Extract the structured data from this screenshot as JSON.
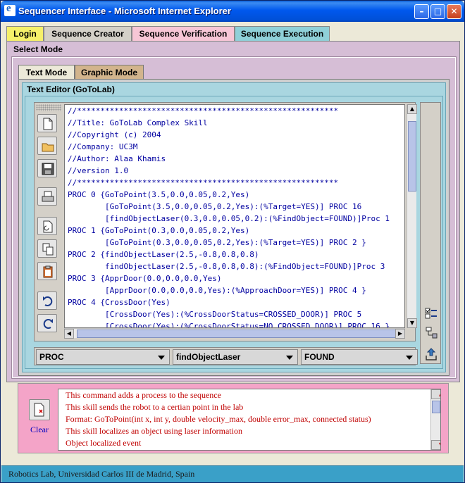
{
  "window": {
    "title": "Sequencer Interface - Microsoft Internet Explorer",
    "minimize_label": "–",
    "maximize_label": "□",
    "close_label": "✕"
  },
  "tabs": [
    {
      "label": "Login",
      "color": "#f5f06a",
      "active": true
    },
    {
      "label": "Sequence Creator",
      "color": "#d4d0c8",
      "active": false
    },
    {
      "label": "Sequence Verification",
      "color": "#f7c6d6",
      "active": false
    },
    {
      "label": "Sequence Execution",
      "color": "#8fd0d8",
      "active": false
    }
  ],
  "select_mode": {
    "label": "Select Mode",
    "subtabs": [
      {
        "label": "Text Mode",
        "color": "#ece9d8",
        "active": true
      },
      {
        "label": "Graphic Mode",
        "color": "#d2b48c",
        "active": false
      }
    ]
  },
  "text_editor": {
    "label": "Text Editor (GoToLab)",
    "lines": [
      "//********************************************************",
      "//Title: GoToLab Complex Skill",
      "//Copyright (c) 2004",
      "//Company: UC3M",
      "//Author: Alaa Khamis",
      "//version 1.0",
      "//********************************************************",
      "PROC 0 {GoToPoint(3.5,0.0,0.05,0.2,Yes)",
      "        [GoToPoint(3.5,0.0,0.05,0.2,Yes):(%Target=YES)] PROC 16",
      "        [findObjectLaser(0.3,0.0,0.05,0.2):(%FindObject=FOUND)]Proc 1",
      "PROC 1 {GoToPoint(0.3,0.0,0.05,0.2,Yes)",
      "        [GoToPoint(0.3,0.0,0.05,0.2,Yes):(%Target=YES)] PROC 2 }",
      "PROC 2 {findObjectLaser(2.5,-0.8,0.8,0.8)",
      "        findObjectLaser(2.5,-0.8,0.8,0.8):(%FindObject=FOUND)]Proc 3",
      "PROC 3 {ApprDoor(0.0,0.0,0.0,Yes)",
      "        [ApprDoor(0.0,0.0,0.0,Yes):(%ApproachDoor=YES)] PROC 4 }",
      "PROC 4 {CrossDoor(Yes)",
      "        [CrossDoor(Yes):(%CrossDoorStatus=CROSSED_DOOR)] PROC 5",
      "        [CrossDoor(Yes):(%CrossDoorStatus=NO_CROSSED_DOOR)] PROC 16 }"
    ]
  },
  "toolbar_icons": [
    "new-file-icon",
    "open-folder-icon",
    "save-icon",
    "print-icon",
    "paste-icon",
    "copy-icon",
    "clipboard-icon",
    "undo-icon",
    "redo-icon"
  ],
  "combos": [
    {
      "value": "PROC"
    },
    {
      "value": "findObjectLaser"
    },
    {
      "value": "FOUND"
    }
  ],
  "messages": {
    "clear_label": "Clear",
    "lines": [
      "This command adds a process to the sequence",
      "This skill sends the robot to a certian point in the lab",
      "Format: GoToPoint(int x, int y, double velocity_max, double error_max, connected status)",
      "This skill localizes an object using laser information",
      "Object localized event"
    ]
  },
  "status_bar": "Robotics Lab, Universidad Carlos III de Madrid, Spain"
}
